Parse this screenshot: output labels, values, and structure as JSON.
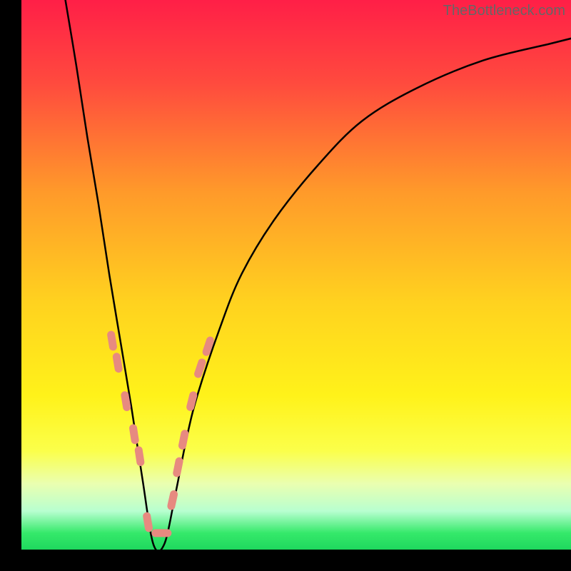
{
  "watermark": "TheBottleneck.com",
  "chart_data": {
    "type": "line",
    "title": "",
    "xlabel": "",
    "ylabel": "",
    "xlim": [
      0,
      100
    ],
    "ylim": [
      0,
      100
    ],
    "note": "Bottleneck / mismatch curve. x is roughly relative component score; y is bottleneck percentage. Gradient background from red (high bottleneck) through orange/yellow to green (no bottleneck). Minimum of curve near x≈24 at y≈0.",
    "series": [
      {
        "name": "bottleneck-curve",
        "x": [
          8,
          10,
          12,
          14,
          16,
          18,
          20,
          22,
          24,
          26,
          28,
          30,
          32,
          36,
          40,
          46,
          54,
          62,
          72,
          84,
          96,
          100
        ],
        "y": [
          100,
          88,
          75,
          63,
          50,
          38,
          26,
          13,
          1,
          1,
          10,
          20,
          28,
          40,
          50,
          60,
          70,
          78,
          84,
          89,
          92,
          93
        ]
      }
    ],
    "markers": {
      "name": "highlighted-points",
      "note": "Salmon lozenge markers on lower portion of both arms of the V",
      "x": [
        16.5,
        17.5,
        19,
        20.5,
        21.5,
        23,
        25.5,
        27.5,
        28.5,
        29.5,
        31,
        32.5,
        34
      ],
      "y": [
        38,
        34,
        27,
        21,
        17,
        5,
        3,
        9,
        15,
        20,
        27,
        33,
        37
      ]
    },
    "gradient_stops": [
      {
        "offset": 0.0,
        "color": "#ff1f47"
      },
      {
        "offset": 0.15,
        "color": "#ff4a3e"
      },
      {
        "offset": 0.35,
        "color": "#ff9a2a"
      },
      {
        "offset": 0.55,
        "color": "#ffd21f"
      },
      {
        "offset": 0.72,
        "color": "#fff21a"
      },
      {
        "offset": 0.82,
        "color": "#fbff4a"
      },
      {
        "offset": 0.88,
        "color": "#eaffb0"
      },
      {
        "offset": 0.93,
        "color": "#b8ffd0"
      },
      {
        "offset": 0.97,
        "color": "#35e96a"
      },
      {
        "offset": 1.0,
        "color": "#1fd85e"
      }
    ]
  }
}
